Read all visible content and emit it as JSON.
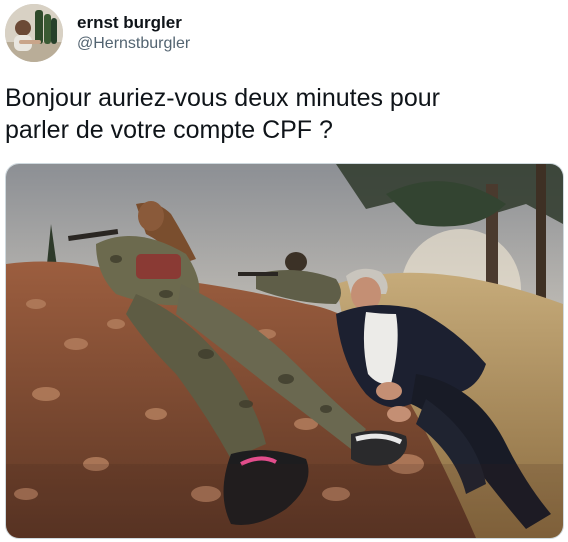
{
  "tweet": {
    "author": {
      "display_name": "ernst burgler",
      "handle": "@Hernstburgler"
    },
    "text_line_1": "Bonjour auriez-vous deux minutes pour",
    "text_line_2": "parler de votre compte CPF ?"
  },
  "colors": {
    "text_primary": "#0f1419",
    "text_secondary": "#536471",
    "media_border": "#cfd9de"
  },
  "icons": {
    "avatar": "avatar-photo",
    "media": "photo"
  }
}
